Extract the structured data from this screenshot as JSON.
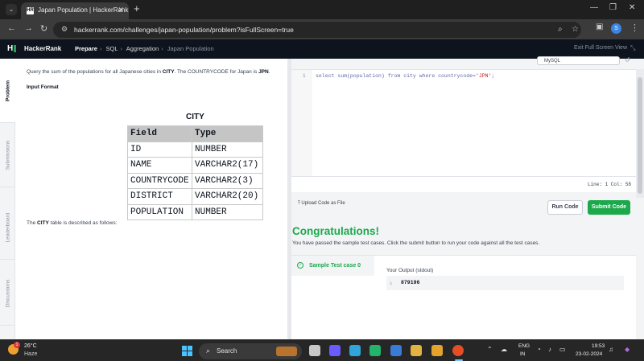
{
  "browser": {
    "tab_title": "Japan Population | HackerRank",
    "tab_favicon": "HR",
    "url": "hackerrank.com/challenges/japan-population/problem?isFullScreen=true",
    "profile_initial": "S",
    "icons": [
      "tab-search-icon",
      "close-icon",
      "new-tab-icon",
      "minimize-icon",
      "restore-icon",
      "close-window-icon",
      "back-icon",
      "forward-icon",
      "reload-icon",
      "site-info-icon",
      "zoom-icon",
      "bookmark-star-icon",
      "side-panel-icon",
      "menu-icon"
    ]
  },
  "header": {
    "brand": "HackerRank",
    "breadcrumbs": [
      "Prepare",
      "SQL",
      "Aggregation",
      "Japan Population"
    ],
    "exit_fullscreen": "Exit Full Screen View"
  },
  "vertical_tabs": [
    "Problem",
    "Submissions",
    "Leaderboard",
    "Discussions"
  ],
  "problem": {
    "statement": {
      "before_city": "Query the sum of the populations for all Japanese cities in ",
      "city": "CITY",
      "middle": ". The COUNTRYCODE for Japan is ",
      "code": "JPN",
      "end": "."
    },
    "input_format": "Input Format",
    "table_title": "CITY",
    "table_headers": [
      "Field",
      "Type"
    ],
    "table_rows": [
      [
        "ID",
        "NUMBER"
      ],
      [
        "NAME",
        "VARCHAR2(17)"
      ],
      [
        "COUNTRYCODE",
        "VARCHAR2(3)"
      ],
      [
        "DISTRICT",
        "VARCHAR2(20)"
      ],
      [
        "POPULATION",
        "NUMBER"
      ]
    ],
    "description": {
      "prefix": "The ",
      "table": "CITY",
      "suffix": " table is described as follows:"
    }
  },
  "editor": {
    "language": "MySQL",
    "line_number": "1",
    "code_main": "select sum(population) from city where countrycode=",
    "code_string": "'JPN'",
    "code_end": ";",
    "line_col": "Line: 1 Col: 58",
    "upload": "Upload Code as File",
    "run_label": "Run Code",
    "submit_label": "Submit Code"
  },
  "result": {
    "heading": "Congratulations!",
    "message": "You have passed the sample test cases. Click the submit button to run your code against all the test cases.",
    "test_case": "Sample Test case 0",
    "output_label": "Your Output (stdout)",
    "output_line": "1",
    "output_value": "879196"
  },
  "taskbar": {
    "temperature": "26°C",
    "condition": "Haze",
    "weather_badge": "1",
    "search": "Search",
    "language_1": "ENG",
    "language_2": "IN",
    "time": "19:53",
    "date": "23-02-2024",
    "app_colors": [
      "#c46f2a",
      "#c9c9c9",
      "#6a5cff",
      "#2fa5d9",
      "#23b36a",
      "#3a7bd5",
      "#e3b341",
      "#e5a32b",
      "#e44d26"
    ]
  },
  "colors": {
    "accent_green": "#1ba94c",
    "header_bg": "#0e141e"
  }
}
